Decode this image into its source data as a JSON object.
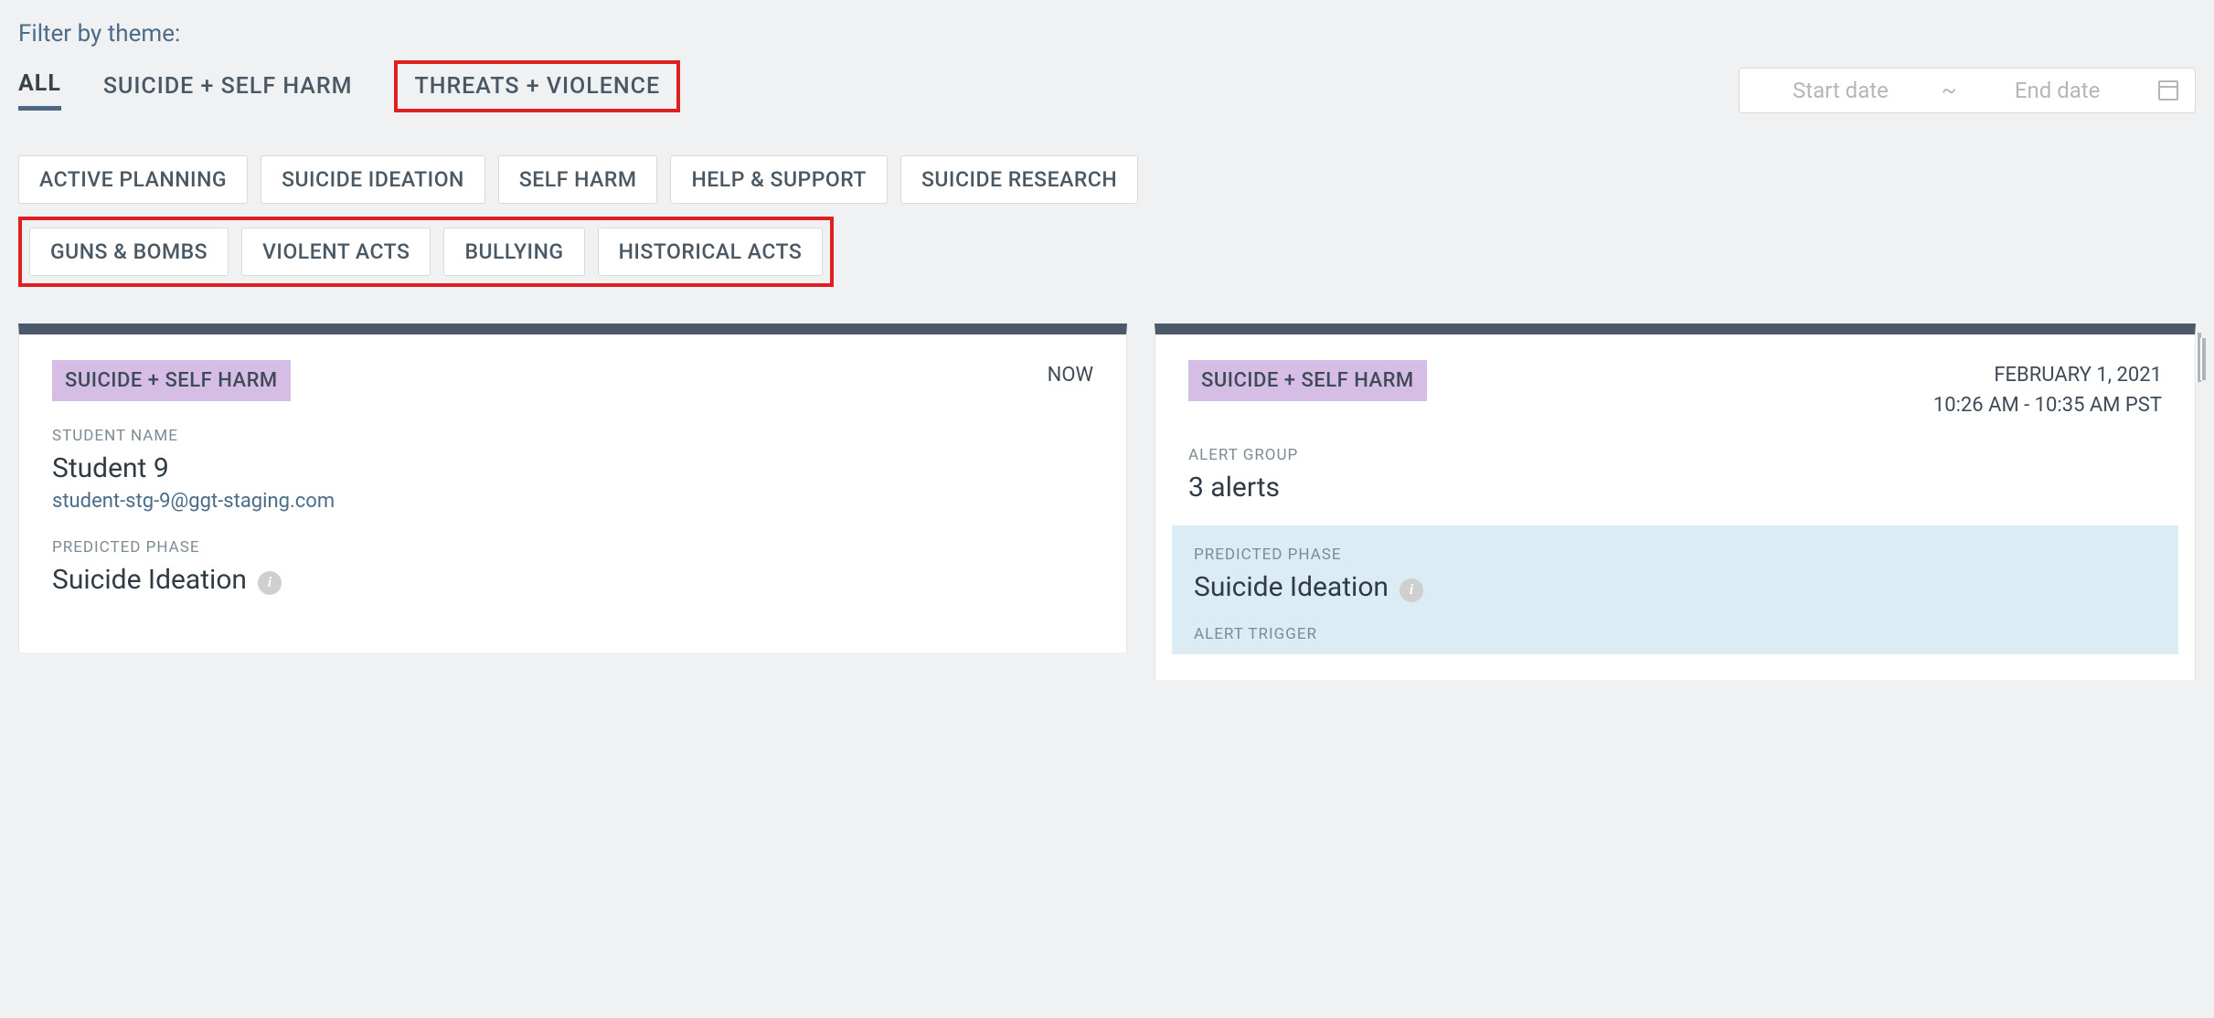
{
  "filter_label": "Filter by theme:",
  "tabs": {
    "all": "ALL",
    "suicide": "SUICIDE + SELF HARM",
    "threats": "THREATS + VIOLENCE"
  },
  "date_picker": {
    "start_placeholder": "Start date",
    "separator": "~",
    "end_placeholder": "End date"
  },
  "chips_row1": {
    "active_planning": "ACTIVE PLANNING",
    "suicide_ideation": "SUICIDE IDEATION",
    "self_harm": "SELF HARM",
    "help_support": "HELP & SUPPORT",
    "suicide_research": "SUICIDE RESEARCH"
  },
  "chips_row2": {
    "guns_bombs": "GUNS & BOMBS",
    "violent_acts": "VIOLENT ACTS",
    "bullying": "BULLYING",
    "historical_acts": "HISTORICAL ACTS"
  },
  "card1": {
    "badge": "SUICIDE + SELF HARM",
    "timestamp": "NOW",
    "student_name_label": "STUDENT NAME",
    "student_name": "Student 9",
    "student_email": "student-stg-9@ggt-staging.com",
    "predicted_phase_label": "PREDICTED PHASE",
    "predicted_phase": "Suicide Ideation"
  },
  "card2": {
    "badge": "SUICIDE + SELF HARM",
    "date": "FEBRUARY 1, 2021",
    "time_range": "10:26 AM - 10:35 AM PST",
    "alert_group_label": "ALERT GROUP",
    "alert_group_value": "3 alerts",
    "predicted_phase_label": "PREDICTED PHASE",
    "predicted_phase": "Suicide Ideation",
    "alert_trigger_label": "ALERT TRIGGER"
  },
  "info_glyph": "i"
}
